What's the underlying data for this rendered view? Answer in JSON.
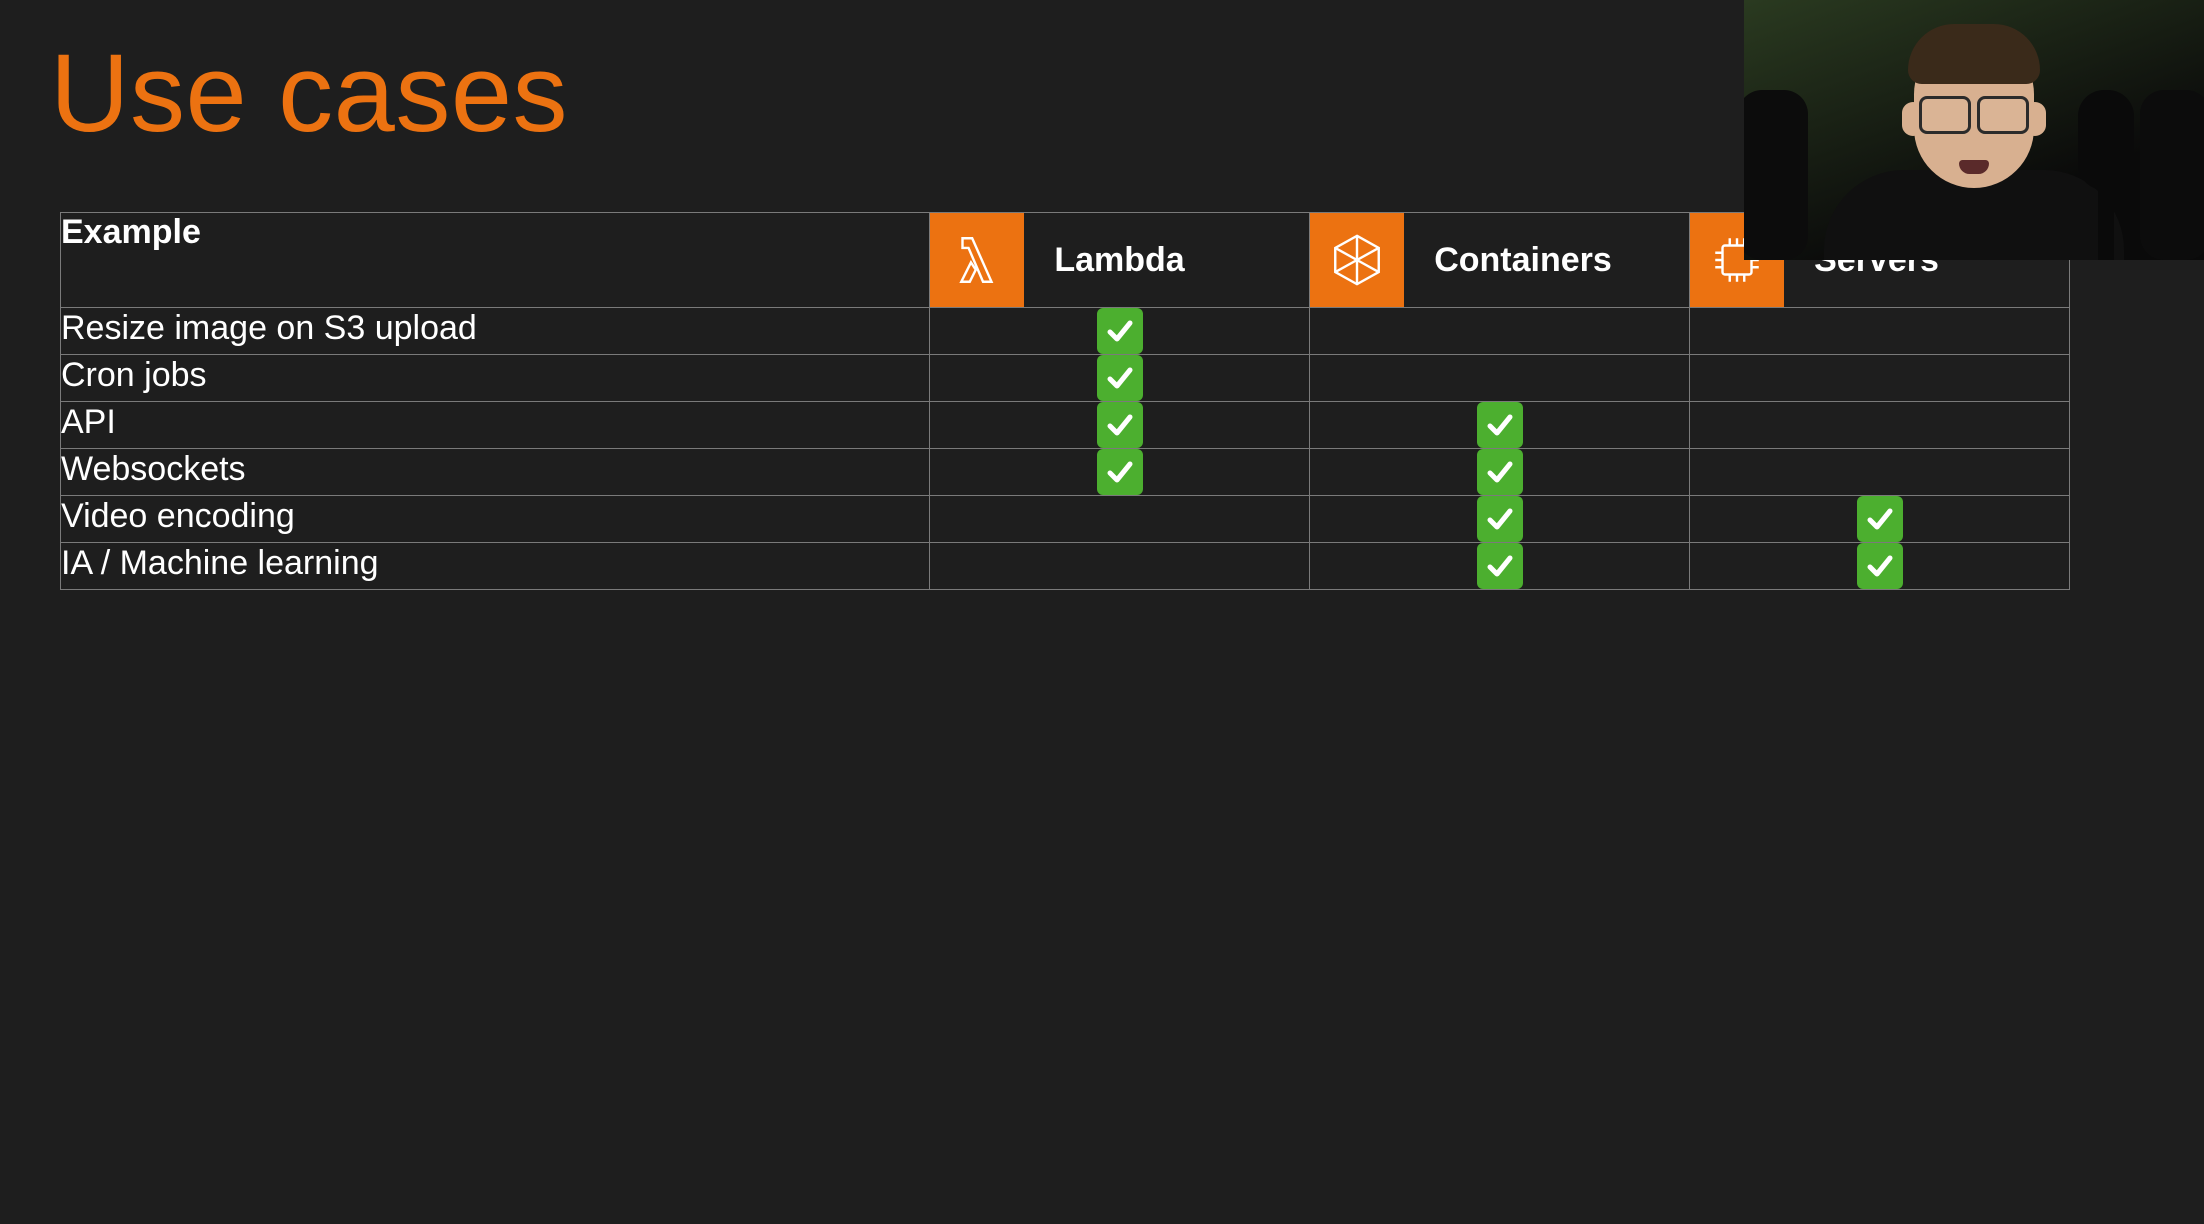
{
  "title": "Use cases",
  "columns": {
    "example": "Example",
    "compute": [
      {
        "id": "lambda",
        "label": "Lambda",
        "icon": "lambda-icon"
      },
      {
        "id": "containers",
        "label": "Containers",
        "icon": "container-icon"
      },
      {
        "id": "servers",
        "label": "Servers",
        "icon": "server-chip-icon"
      }
    ]
  },
  "rows": [
    {
      "label": "Resize image on S3 upload",
      "lambda": true,
      "containers": false,
      "servers": false
    },
    {
      "label": "Cron jobs",
      "lambda": true,
      "containers": false,
      "servers": false
    },
    {
      "label": "API",
      "lambda": true,
      "containers": true,
      "servers": false
    },
    {
      "label": "Websockets",
      "lambda": true,
      "containers": true,
      "servers": false
    },
    {
      "label": "Video encoding",
      "lambda": false,
      "containers": true,
      "servers": true
    },
    {
      "label": "IA / Machine learning",
      "lambda": false,
      "containers": true,
      "servers": true
    }
  ],
  "chart_data": {
    "type": "table",
    "title": "Use cases",
    "columns": [
      "Example",
      "Lambda",
      "Containers",
      "Servers"
    ],
    "rows": [
      [
        "Resize image on S3 upload",
        true,
        false,
        false
      ],
      [
        "Cron jobs",
        true,
        false,
        false
      ],
      [
        "API",
        true,
        true,
        false
      ],
      [
        "Websockets",
        true,
        true,
        false
      ],
      [
        "Video encoding",
        false,
        true,
        true
      ],
      [
        "IA / Machine learning",
        false,
        true,
        true
      ]
    ]
  },
  "colors": {
    "accent": "#ec7211",
    "check": "#4caf2f",
    "bg": "#1e1e1e",
    "border": "#7a7a7a"
  }
}
